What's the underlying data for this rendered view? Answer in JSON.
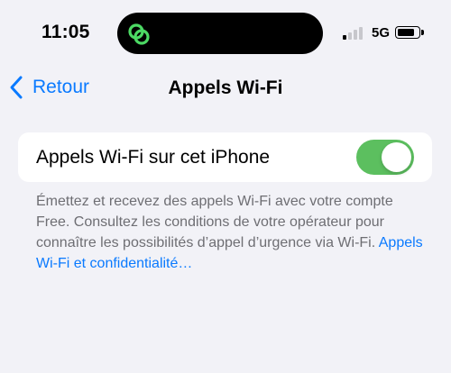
{
  "status_bar": {
    "time": "11:05",
    "network": "5G",
    "signal_bars_active": 1,
    "colors": {
      "island_icon": "#4cd964"
    }
  },
  "nav": {
    "back_label": "Retour",
    "title": "Appels Wi-Fi"
  },
  "settings": {
    "row_label": "Appels Wi-Fi sur cet iPhone",
    "toggle_on": true,
    "colors": {
      "toggle_on": "#5cbf5f",
      "accent": "#0a7aff"
    }
  },
  "footer": {
    "description": "Émettez et recevez des appels Wi-Fi avec votre compte Free. Consultez les conditions de votre opérateur pour connaître les possibilités d’appel d’urgence via Wi-Fi.",
    "link_label": "Appels Wi-Fi et confidentialité…"
  }
}
